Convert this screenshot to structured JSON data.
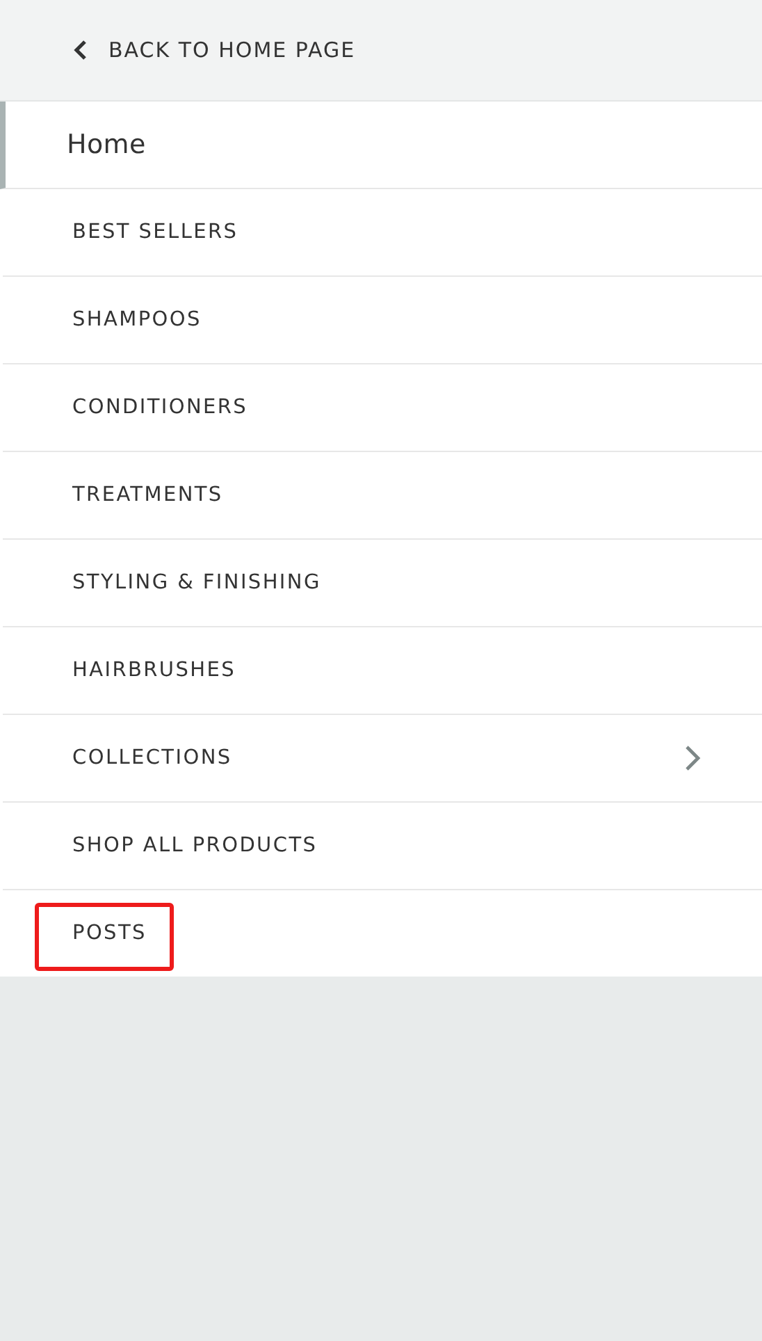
{
  "back_link": {
    "label": "BACK TO HOME PAGE"
  },
  "menu": {
    "items": [
      {
        "label": "Home",
        "kind": "heading",
        "selected": true,
        "highlighted": false
      },
      {
        "label": "BEST SELLERS",
        "kind": "link",
        "selected": false,
        "highlighted": false
      },
      {
        "label": "SHAMPOOS",
        "kind": "link",
        "selected": false,
        "highlighted": false
      },
      {
        "label": "CONDITIONERS",
        "kind": "link",
        "selected": false,
        "highlighted": false
      },
      {
        "label": "TREATMENTS",
        "kind": "link",
        "selected": false,
        "highlighted": false
      },
      {
        "label": "STYLING & FINISHING",
        "kind": "link",
        "selected": false,
        "highlighted": false
      },
      {
        "label": "HAIRBRUSHES",
        "kind": "link",
        "selected": false,
        "highlighted": false
      },
      {
        "label": "COLLECTIONS",
        "kind": "submenu",
        "selected": false,
        "highlighted": false
      },
      {
        "label": "SHOP ALL PRODUCTS",
        "kind": "link",
        "selected": false,
        "highlighted": false
      },
      {
        "label": "POSTS",
        "kind": "link",
        "selected": false,
        "highlighted": true
      }
    ]
  }
}
